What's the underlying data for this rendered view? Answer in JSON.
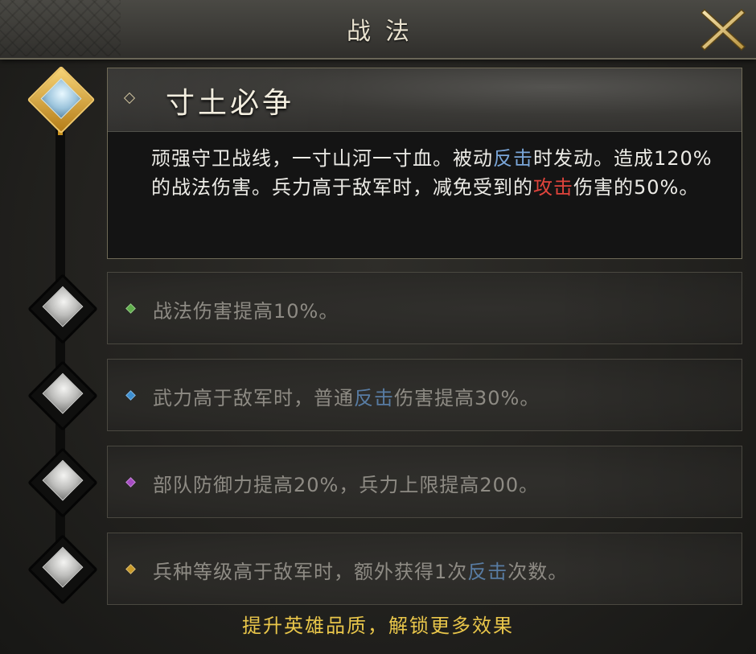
{
  "header": {
    "title": "战法",
    "close_icon": "close-icon"
  },
  "main_skill": {
    "name": "寸土必争",
    "desc_parts": [
      {
        "text": "顽强守卫战线，一寸山河一寸血。被动",
        "kind": "normal"
      },
      {
        "text": "反击",
        "kind": "blue"
      },
      {
        "text": "时发动。造成120%的战法伤害。兵力高于敌军时，减免受到的",
        "kind": "normal"
      },
      {
        "text": "攻击",
        "kind": "red"
      },
      {
        "text": "伤害的50%。",
        "kind": "normal"
      }
    ],
    "node_icon": "gem-icon"
  },
  "upgrades": [
    {
      "parts": [
        {
          "text": "战法伤害提高10%。",
          "kind": "normal"
        }
      ],
      "dot_color": "#5fae4b",
      "node_icon": "beast-emblem-icon"
    },
    {
      "parts": [
        {
          "text": "武力高于敌军时，普通",
          "kind": "normal"
        },
        {
          "text": "反击",
          "kind": "blue"
        },
        {
          "text": "伤害提高30%。",
          "kind": "normal"
        }
      ],
      "dot_color": "#3d8fd1",
      "node_icon": "dragon-emblem-icon"
    },
    {
      "parts": [
        {
          "text": "部队防御力提高20%，兵力上限提高200。",
          "kind": "normal"
        }
      ],
      "dot_color": "#a64bc2",
      "node_icon": "cloud-emblem-icon"
    },
    {
      "parts": [
        {
          "text": "兵种等级高于敌军时，额外获得1次",
          "kind": "normal"
        },
        {
          "text": "反击",
          "kind": "blue"
        },
        {
          "text": "次数。",
          "kind": "normal"
        }
      ],
      "dot_color": "#c89a2a",
      "node_icon": "gem-icon"
    }
  ],
  "footer": {
    "hint": "提升英雄品质，解锁更多效果"
  },
  "colors": {
    "accent_gold": "#e9c64a",
    "keyword_blue": "#7aa6d9",
    "keyword_red": "#e0443c"
  }
}
